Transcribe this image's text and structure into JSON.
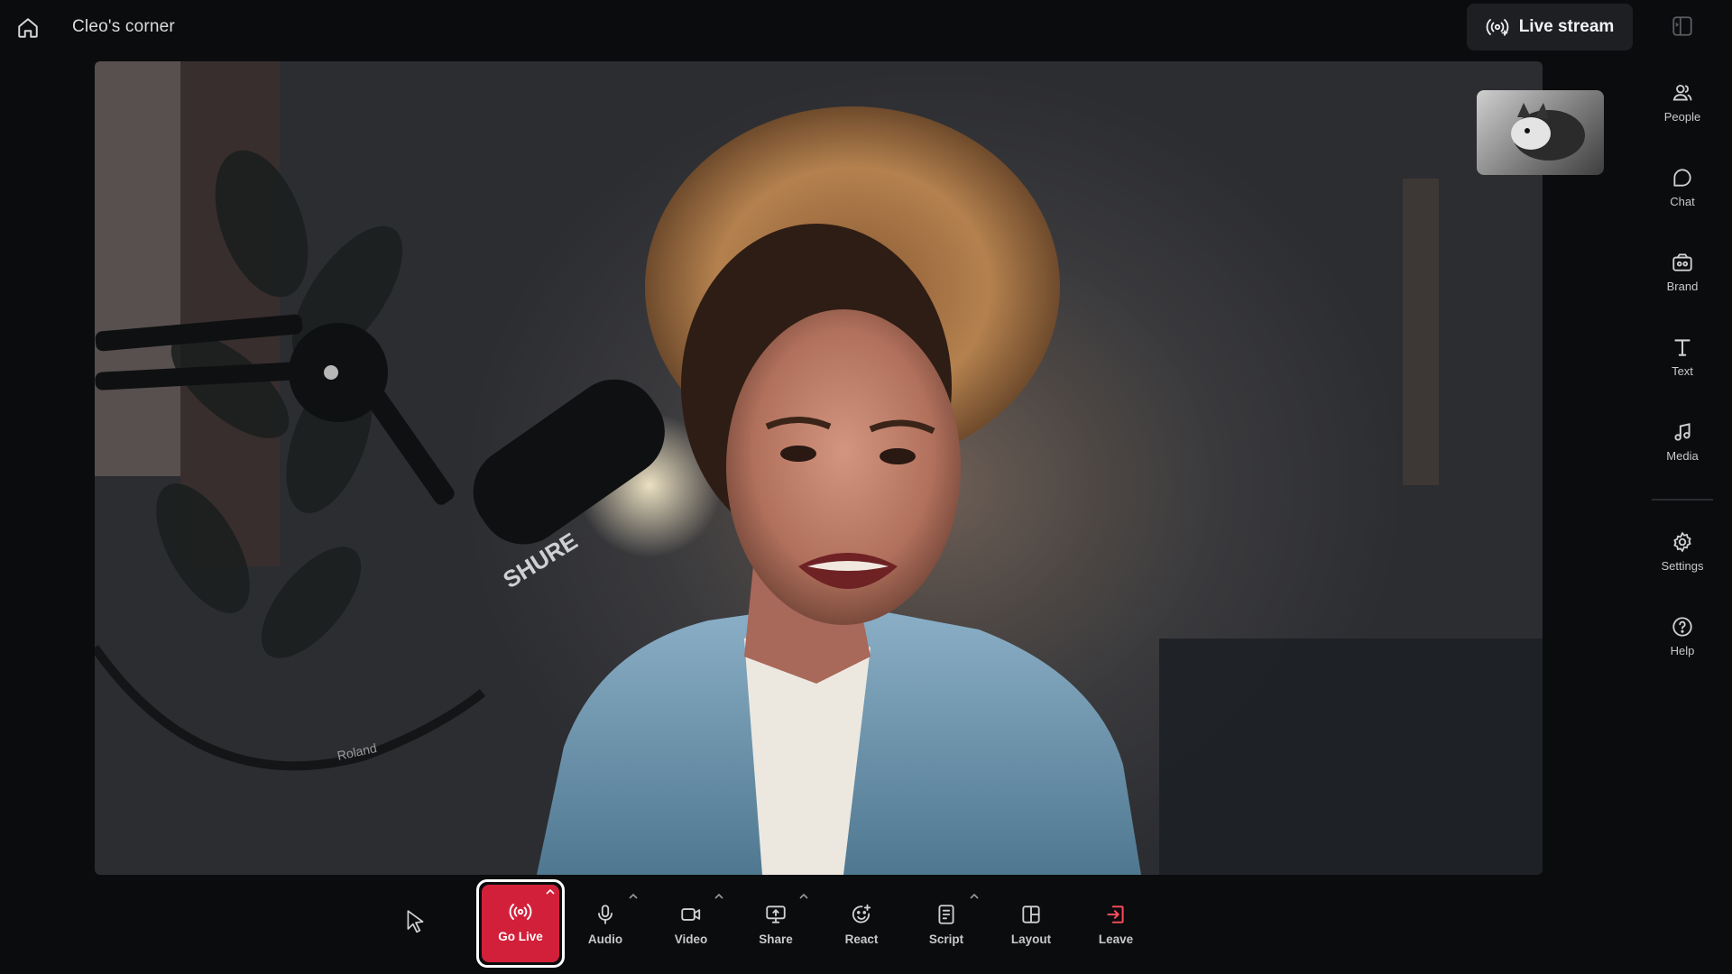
{
  "header": {
    "home_icon": "home-icon",
    "room_title": "Cleo's corner",
    "live_stream_label": "Live stream",
    "live_stream_icon": "broadcast-icon",
    "panel_icon": "panel-toggle-icon"
  },
  "sidebar": {
    "items": [
      {
        "label": "People",
        "icon": "people-icon"
      },
      {
        "label": "Chat",
        "icon": "chat-icon"
      },
      {
        "label": "Brand",
        "icon": "brand-icon"
      },
      {
        "label": "Text",
        "icon": "text-icon"
      },
      {
        "label": "Media",
        "icon": "music-note-icon"
      },
      {
        "label": "Settings",
        "icon": "gear-icon"
      },
      {
        "label": "Help",
        "icon": "help-icon"
      }
    ]
  },
  "controls": {
    "go_live": "Go Live",
    "audio": "Audio",
    "video": "Video",
    "share": "Share",
    "react": "React",
    "script": "Script",
    "layout": "Layout",
    "leave": "Leave"
  },
  "stage": {
    "microphone_brand": "SHURE",
    "cable_brand": "Roland"
  },
  "colors": {
    "go_live_red": "#d3203a",
    "leave_red": "#ff4d5e",
    "background": "#0b0c0e"
  }
}
